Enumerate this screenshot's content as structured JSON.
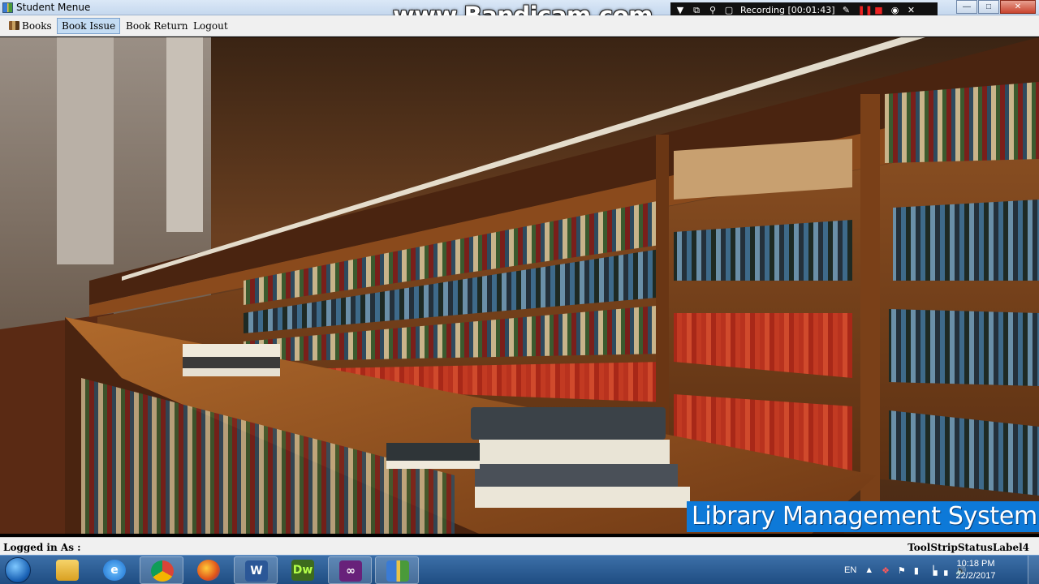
{
  "window": {
    "title": "Student Menue"
  },
  "watermark": {
    "text": "www.Bandicam.com",
    "recording": "Recording [00:01:43]"
  },
  "menu": {
    "books": "Books",
    "book_issue": "Book Issue",
    "book_return": "Book Return",
    "logout": "Logout"
  },
  "banner": {
    "text": "Library Management System",
    "bg": "#0d79d8"
  },
  "status": {
    "left": "Logged in As :",
    "right": "ToolStripStatusLabel4"
  },
  "taskbar": {
    "apps": [
      "start-orb-icon",
      "file-explorer-icon",
      "internet-explorer-icon",
      "chrome-icon",
      "firefox-icon",
      "word-icon",
      "dreamweaver-icon",
      "visual-studio-icon",
      "library-app-icon"
    ],
    "word_label": "W",
    "dw_label": "Dw",
    "lang": "EN",
    "time": "10:18 PM",
    "date": "22/2/2017"
  }
}
